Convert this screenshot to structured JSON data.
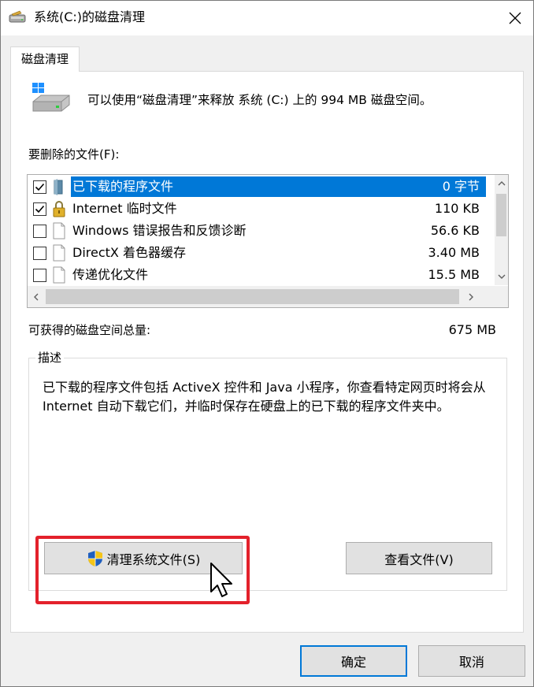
{
  "window": {
    "title": "系统(C:)的磁盘清理"
  },
  "tab": {
    "label": "磁盘清理"
  },
  "summary": {
    "text": "可以使用“磁盘清理”来释放 系统 (C:) 上的 994 MB 磁盘空间。"
  },
  "files_label": "要删除的文件(F):",
  "files": [
    {
      "name": "已下载的程序文件",
      "size": "0 字节",
      "checked": true,
      "selected": true,
      "icon": "folder-icon"
    },
    {
      "name": "Internet 临时文件",
      "size": "110 KB",
      "checked": true,
      "selected": false,
      "icon": "lock-icon"
    },
    {
      "name": "Windows 错误报告和反馈诊断",
      "size": "56.6 KB",
      "checked": false,
      "selected": false,
      "icon": "file-icon"
    },
    {
      "name": "DirectX 着色器缓存",
      "size": "3.40 MB",
      "checked": false,
      "selected": false,
      "icon": "file-icon"
    },
    {
      "name": "传递优化文件",
      "size": "15.5 MB",
      "checked": false,
      "selected": false,
      "icon": "file-icon"
    }
  ],
  "space": {
    "label": "可获得的磁盘空间总量:",
    "value": "675 MB"
  },
  "description": {
    "title": "描述",
    "text": "已下载的程序文件包括 ActiveX 控件和 Java 小程序，你查看特定网页时将会从 Internet 自动下载它们，并临时保存在硬盘上的已下载的程序文件夹中。"
  },
  "buttons": {
    "cleanup_system": "清理系统文件(S)",
    "view_files": "查看文件(V)",
    "ok": "确定",
    "cancel": "取消"
  },
  "colors": {
    "selection": "#0078d7",
    "highlight_box": "#e3212b"
  }
}
